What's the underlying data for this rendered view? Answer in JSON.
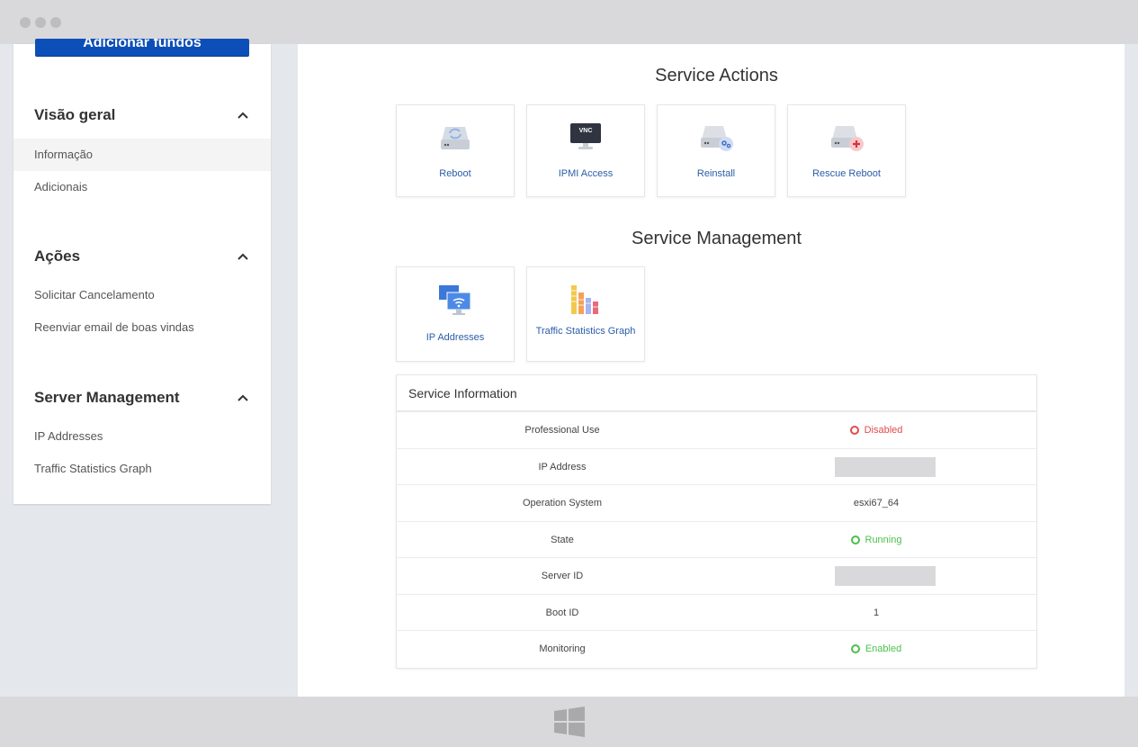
{
  "sidebar": {
    "add_button_label": "Adicionar fundos",
    "sections": [
      {
        "title": "Visão geral",
        "items": [
          "Informação",
          "Adicionais"
        ]
      },
      {
        "title": "Ações",
        "items": [
          "Solicitar Cancelamento",
          "Reenviar email de boas vindas"
        ]
      },
      {
        "title": "Server Management",
        "items": [
          "IP Addresses",
          "Traffic Statistics Graph"
        ]
      }
    ]
  },
  "service_actions": {
    "title": "Service Actions",
    "tiles": [
      {
        "label": "Reboot",
        "icon": "reboot-icon"
      },
      {
        "label": "IPMI Access",
        "icon": "vnc-monitor-icon",
        "icon_text": "VNC"
      },
      {
        "label": "Reinstall",
        "icon": "reinstall-icon"
      },
      {
        "label": "Rescue Reboot",
        "icon": "rescue-reboot-icon"
      }
    ]
  },
  "service_management": {
    "title": "Service Management",
    "tiles": [
      {
        "label": "IP Addresses",
        "icon": "ip-addresses-icon"
      },
      {
        "label": "Traffic Statistics Graph",
        "icon": "traffic-graph-icon"
      }
    ]
  },
  "service_information": {
    "title": "Service Information",
    "rows": [
      {
        "label": "Professional Use",
        "value": "Disabled",
        "status": "red"
      },
      {
        "label": "IP Address",
        "value": "",
        "redacted": true
      },
      {
        "label": "Operation System",
        "value": "esxi67_64"
      },
      {
        "label": "State",
        "value": "Running",
        "status": "green"
      },
      {
        "label": "Server ID",
        "value": "",
        "redacted": true
      },
      {
        "label": "Boot ID",
        "value": "1"
      },
      {
        "label": "Monitoring",
        "value": "Enabled",
        "status": "green"
      }
    ]
  },
  "colors": {
    "primary": "#0d4fb8",
    "link": "#2a5ca8",
    "danger": "#e34a4a",
    "success": "#4cbf4c"
  }
}
